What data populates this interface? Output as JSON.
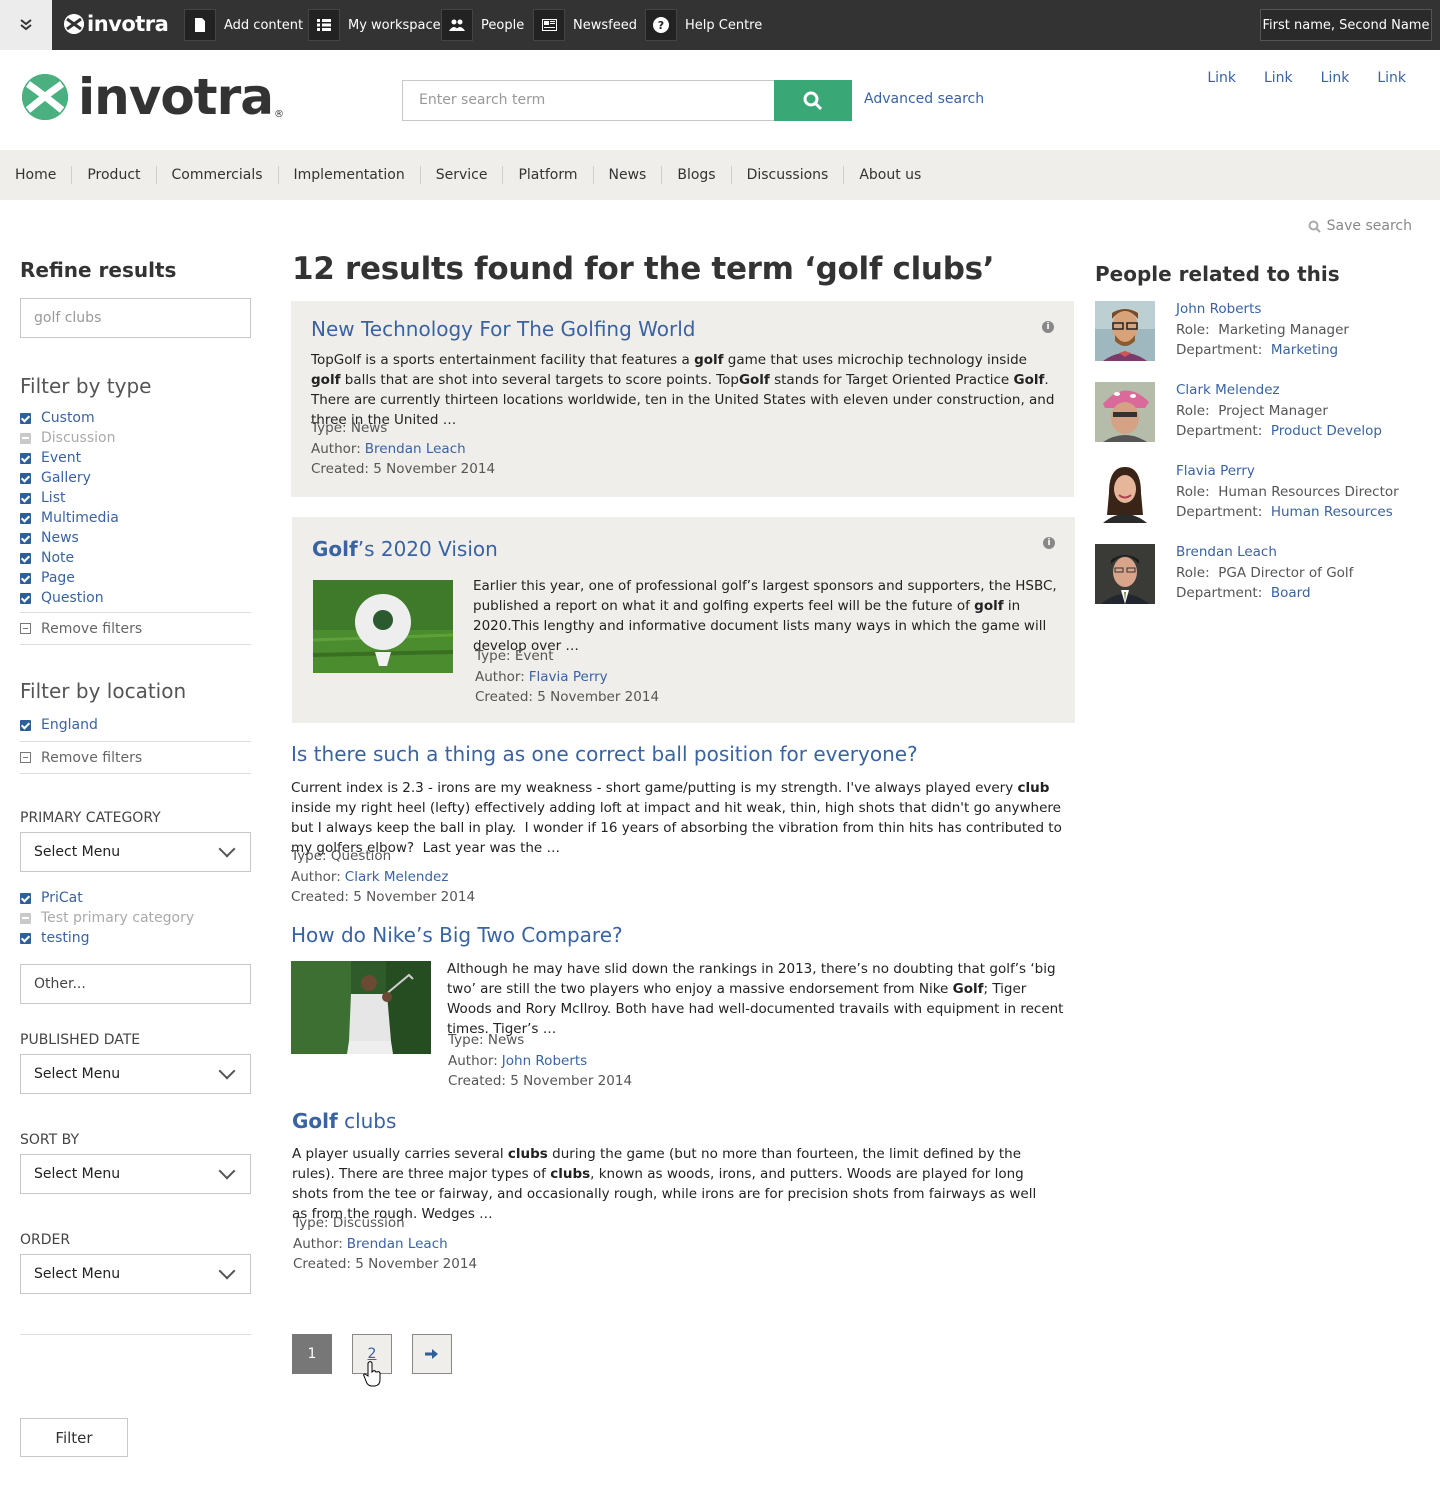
{
  "topbar": {
    "logo_text": "invotra",
    "items": [
      "Add content",
      "My workspace",
      "People",
      "Newsfeed",
      "Help Centre"
    ],
    "user": "First name, Second Name"
  },
  "header": {
    "logo_text": "invotra",
    "search_placeholder": "Enter search term",
    "advanced_search": "Advanced search",
    "links": [
      "Link",
      "Link",
      "Link",
      "Link"
    ]
  },
  "nav": [
    "Home",
    "Product",
    "Commercials",
    "Implementation",
    "Service",
    "Platform",
    "News",
    "Blogs",
    "Discussions",
    "About us"
  ],
  "save_search": "Save search",
  "sidebar": {
    "refine_title": "Refine results",
    "refine_value": "golf clubs",
    "type_title": "Filter by type",
    "types": [
      {
        "label": "Custom",
        "state": "checked"
      },
      {
        "label": "Discussion",
        "state": "disabled"
      },
      {
        "label": "Event",
        "state": "checked"
      },
      {
        "label": "Gallery",
        "state": "checked"
      },
      {
        "label": "List",
        "state": "checked"
      },
      {
        "label": "Multimedia",
        "state": "checked"
      },
      {
        "label": "News",
        "state": "checked"
      },
      {
        "label": "Note",
        "state": "checked"
      },
      {
        "label": "Page",
        "state": "checked"
      },
      {
        "label": "Question",
        "state": "checked"
      }
    ],
    "remove_filters": "Remove filters",
    "location_title": "Filter by location",
    "locations": [
      {
        "label": "England",
        "state": "checked"
      }
    ],
    "primary_category_label": "PRIMARY CATEGORY",
    "select_menu": "Select Menu",
    "categories": [
      {
        "label": "PriCat",
        "state": "checked"
      },
      {
        "label": "Test primary category",
        "state": "disabled"
      },
      {
        "label": "testing",
        "state": "checked"
      }
    ],
    "other_value": "Other...",
    "published_date_label": "PUBLISHED DATE",
    "sort_by_label": "SORT BY",
    "order_label": "ORDER",
    "filter_button": "Filter"
  },
  "results": {
    "title": "12 results found for the term ‘golf clubs’",
    "type_label": "Type:",
    "author_label": "Author:",
    "created_label": "Created:",
    "items": [
      {
        "title": "New Technology For The Golfing World",
        "type": "News",
        "author": "Brendan Leach",
        "created": "5 November 2014"
      },
      {
        "title_bold": "Golf",
        "title_rest": "’s 2020 Vision",
        "type": "Event",
        "author": "Flavia Perry",
        "created": "5 November 2014"
      },
      {
        "title": "Is there such a thing as one correct ball position for everyone?",
        "type": "Question",
        "author": "Clark Melendez",
        "created": "5 November 2014"
      },
      {
        "title": "How do Nike’s Big Two Compare?",
        "type": "News",
        "author": "John Roberts",
        "created": "5 November 2014"
      },
      {
        "title_bold": "Golf",
        "title_rest": " clubs",
        "type": "Discussion",
        "author": "Brendan Leach",
        "created": "5 November 2014"
      }
    ]
  },
  "people": {
    "title": "People related to this",
    "role_label": "Role:",
    "dept_label": "Department:",
    "items": [
      {
        "name": "John Roberts",
        "role": "Marketing Manager",
        "dept": "Marketing"
      },
      {
        "name": "Clark Melendez",
        "role": "Project Manager",
        "dept": "Product Develop"
      },
      {
        "name": "Flavia Perry",
        "role": "Human Resources Director",
        "dept": "Human Resources"
      },
      {
        "name": "Brendan Leach",
        "role": "PGA Director of Golf",
        "dept": "Board"
      }
    ]
  },
  "pagination": {
    "pages": [
      "1",
      "2"
    ],
    "current": "1"
  },
  "colors": {
    "accent_green": "#3aa776",
    "link_blue": "#3a63a2",
    "topbar": "#333333",
    "nav_bg": "#efeeea"
  }
}
